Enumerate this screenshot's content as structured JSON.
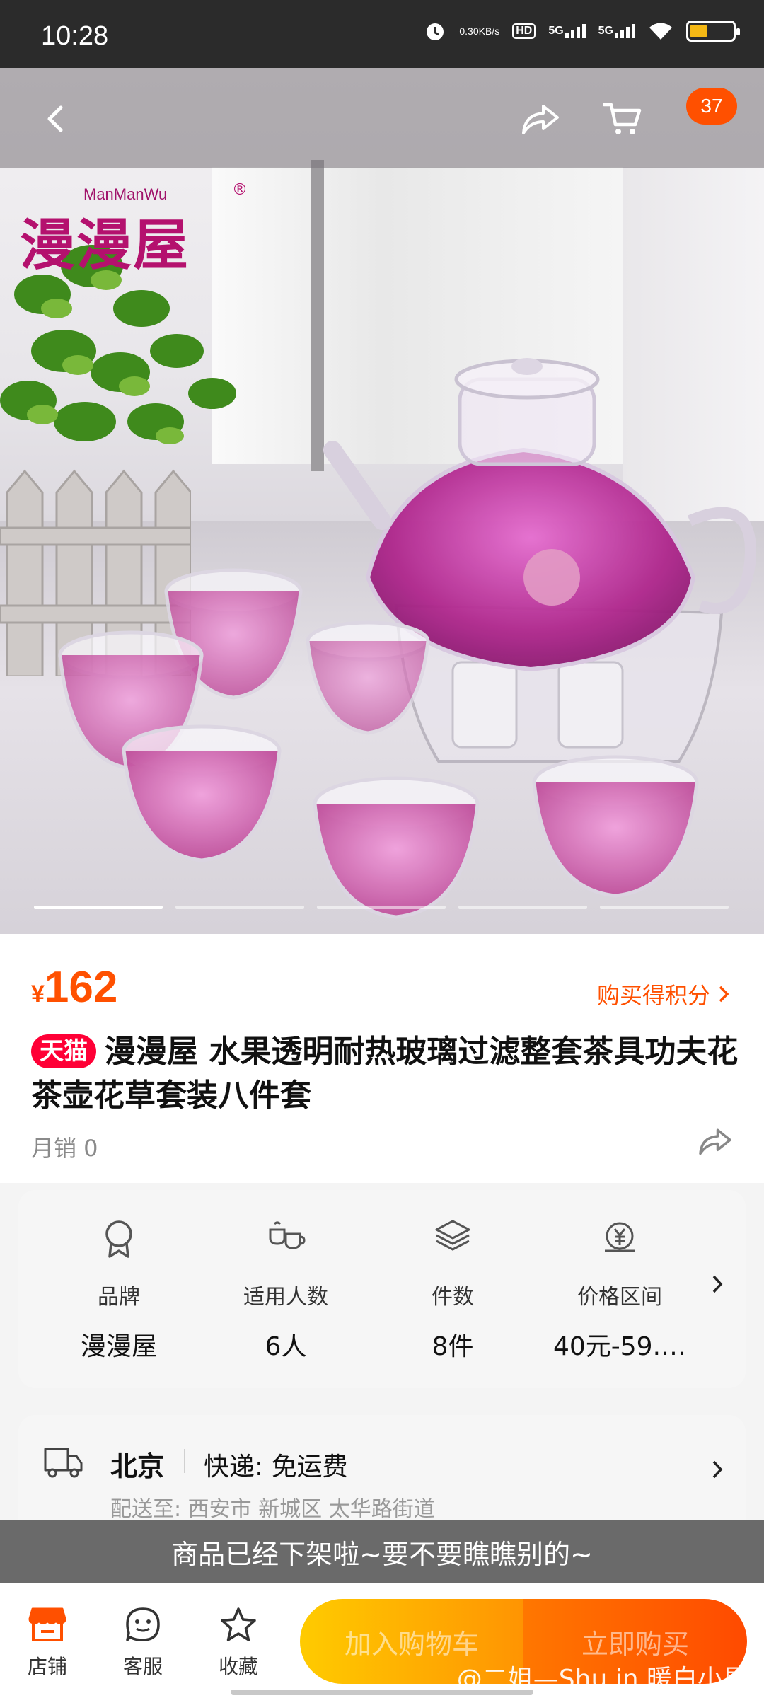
{
  "status_bar": {
    "time": "10:28",
    "net_speed_value": "0.30",
    "net_speed_unit": "KB/s",
    "hd_label": "HD",
    "sim1": "5G",
    "sim2": "5G",
    "battery_level": 0.4
  },
  "nav": {
    "cart_badge": "37"
  },
  "hero": {
    "brand_logo_en": "ManManWu",
    "brand_logo_zh": "漫漫屋",
    "brand_logo_reg": "®",
    "carousel_total": 5,
    "carousel_active": 1
  },
  "product": {
    "currency": "¥",
    "price": "162",
    "points_label": "购买得积分",
    "tmall_tag": "天猫",
    "title": "漫漫屋 水果透明耐热玻璃过滤整套茶具功夫花茶壶花草套装八件套",
    "monthly_sales": "月销 0"
  },
  "params": [
    {
      "icon": "award-icon",
      "label": "品牌",
      "value": "漫漫屋"
    },
    {
      "icon": "teacups-icon",
      "label": "适用人数",
      "value": "6人"
    },
    {
      "icon": "layers-icon",
      "label": "件数",
      "value": "8件"
    },
    {
      "icon": "yen-coin-icon",
      "label": "价格区间",
      "value": "40元-59.…"
    }
  ],
  "delivery": {
    "city": "北京",
    "express": "快递:  免运费",
    "address": "配送至: 西安市 新城区 太华路街道"
  },
  "notice": "商品已经下架啦~要不要瞧瞧别的~",
  "bottom_bar": {
    "shop_label": "店铺",
    "service_label": "客服",
    "favorite_label": "收藏",
    "add_cart_label": "加入购物车",
    "buy_now_label": "立即购买"
  },
  "watermark": "@二姐—Shu in 暖白小屋",
  "colors": {
    "accent": "#ff5000",
    "tmall": "#ff0036",
    "cart_button": "#ffb000",
    "buy_button": "#ff5500"
  }
}
